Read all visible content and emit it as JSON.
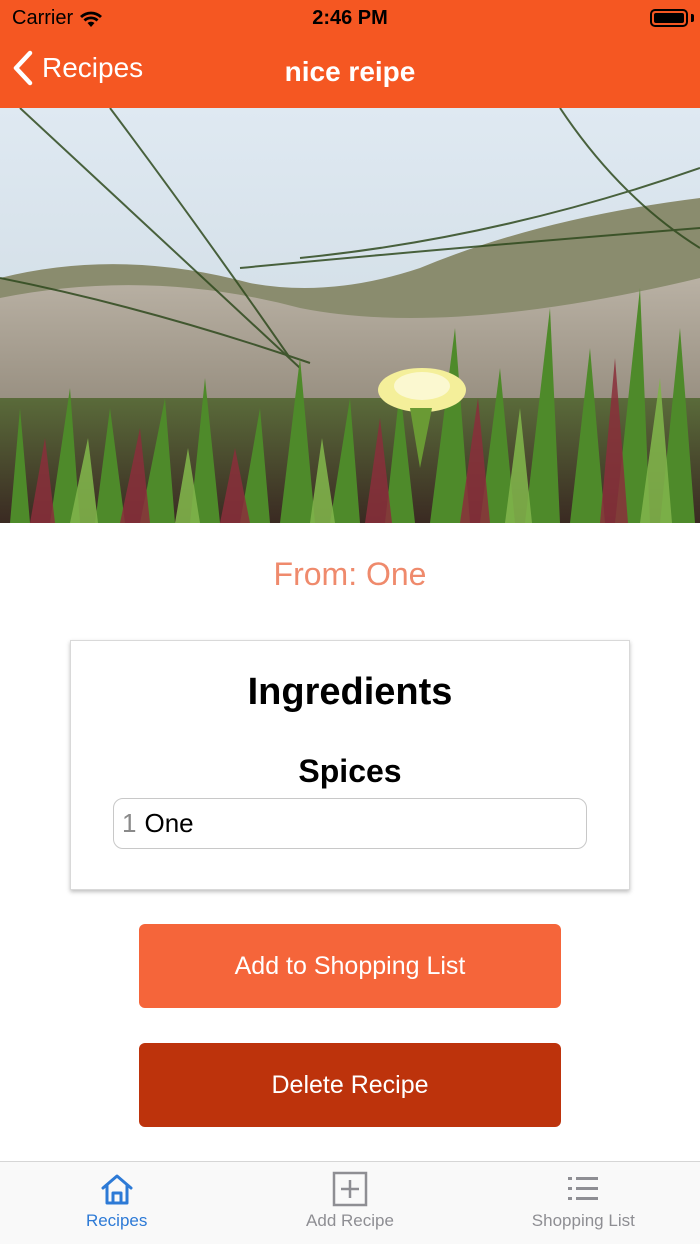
{
  "status_bar": {
    "carrier": "Carrier",
    "time": "2:46 PM"
  },
  "nav": {
    "back_label": "Recipes",
    "title": "nice reipe"
  },
  "recipe": {
    "from_text": "From: One",
    "ingredients_title": "Ingredients",
    "sections": [
      {
        "title": "Spices",
        "items": [
          {
            "quantity": "1",
            "name": "One"
          }
        ]
      }
    ]
  },
  "actions": {
    "add_to_shopping_list": "Add to Shopping List",
    "delete_recipe": "Delete Recipe"
  },
  "tab_bar": {
    "tabs": [
      {
        "label": "Recipes",
        "icon": "home-icon",
        "active": true
      },
      {
        "label": "Add Recipe",
        "icon": "plus-square-icon",
        "active": false
      },
      {
        "label": "Shopping List",
        "icon": "list-icon",
        "active": false
      }
    ]
  },
  "colors": {
    "brand": "#f55722",
    "primary_button": "#f5653a",
    "danger_button": "#bd330c",
    "from_text": "#ef8a6c",
    "tab_active": "#2d7ad6",
    "tab_inactive": "#8e8e93"
  }
}
